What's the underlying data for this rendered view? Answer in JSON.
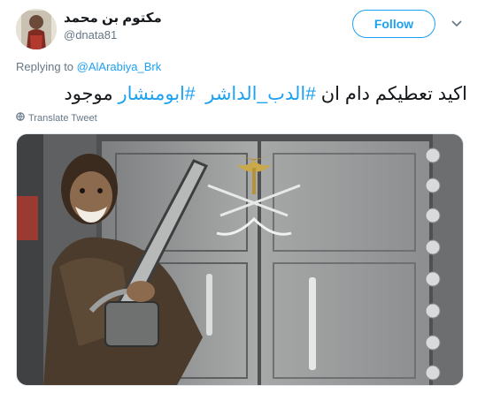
{
  "user": {
    "display_name": "مكتوم بن محمد",
    "handle": "@dnata81"
  },
  "follow_label": "Follow",
  "replying": {
    "prefix": "Replying to ",
    "mention": "@AlArabiya_Brk"
  },
  "tweet": {
    "text_start": "اكيد تعطيكم دام ان ",
    "hashtag_1": "#الدب_الداشر",
    "hashtag_2": "#ابومنشار",
    "text_end": " موجود"
  },
  "translate_label": "Translate Tweet",
  "colors": {
    "accent": "#1da1f2",
    "secondary_text": "#657786",
    "primary_text": "#14171a"
  },
  "icons": {
    "menu": "chevron-down-icon",
    "translate": "globe-icon"
  }
}
